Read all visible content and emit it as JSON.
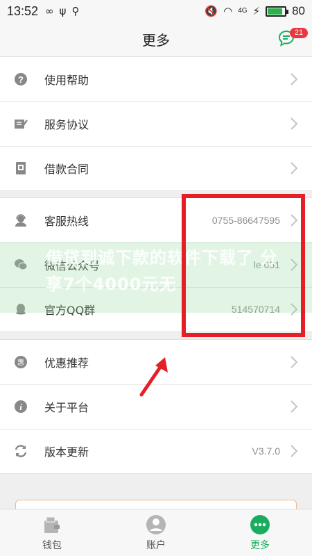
{
  "status_bar": {
    "time": "13:52",
    "battery_percent": "80",
    "battery_level": 0.8,
    "network_label": "4G"
  },
  "header": {
    "title": "更多",
    "message_badge": "21",
    "accent_color": "#1aad5f"
  },
  "groups": [
    {
      "items": [
        {
          "label": "使用帮助",
          "icon": "question-circle-icon"
        },
        {
          "label": "服务协议",
          "icon": "document-edit-icon"
        },
        {
          "label": "借款合同",
          "icon": "contract-icon"
        }
      ]
    },
    {
      "items": [
        {
          "label": "客服热线",
          "value": "0755-86647595",
          "icon": "support-agent-icon"
        },
        {
          "label": "微信公众号",
          "value": "le 051",
          "icon": "wechat-icon"
        },
        {
          "label": "官方QQ群",
          "value": "514570714",
          "icon": "qq-icon"
        }
      ]
    },
    {
      "items": [
        {
          "label": "优惠推荐",
          "icon": "discount-icon"
        },
        {
          "label": "关于平台",
          "icon": "info-icon"
        },
        {
          "label": "版本更新",
          "value": "V3.7.0",
          "icon": "refresh-icon"
        }
      ]
    }
  ],
  "overlay_text": "借贷到诚下款的软件下载了 分享7个4000元无",
  "annotation_color": "#e61f26",
  "tabs": [
    {
      "label": "钱包",
      "icon": "wallet-icon",
      "active": false
    },
    {
      "label": "账户",
      "icon": "user-icon",
      "active": false
    },
    {
      "label": "更多",
      "icon": "more-icon",
      "active": true
    }
  ]
}
